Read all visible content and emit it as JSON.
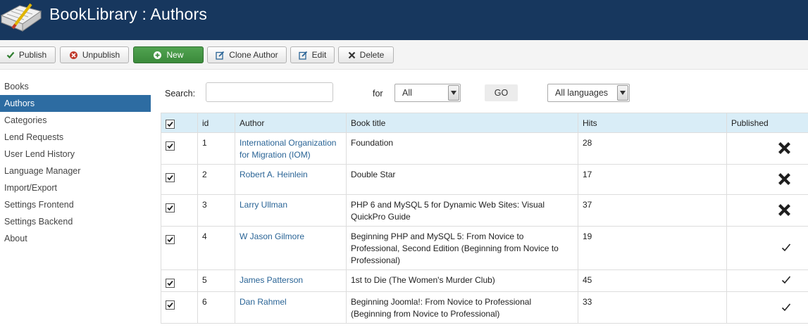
{
  "app": {
    "title": "BookLibrary : Authors",
    "header_color": "#17375e"
  },
  "toolbar": {
    "publish": "Publish",
    "unpublish": "Unpublish",
    "new": "New",
    "clone": "Clone Author",
    "edit": "Edit",
    "delete": "Delete"
  },
  "sidebar": {
    "items": [
      {
        "label": "Books"
      },
      {
        "label": "Authors",
        "active": true
      },
      {
        "label": "Categories"
      },
      {
        "label": "Lend Requests"
      },
      {
        "label": "User Lend History"
      },
      {
        "label": "Language Manager"
      },
      {
        "label": "Import/Export"
      },
      {
        "label": "Settings Frontend"
      },
      {
        "label": "Settings Backend"
      },
      {
        "label": "About"
      }
    ]
  },
  "filters": {
    "search_label": "Search:",
    "search_value": "",
    "for_label": "for",
    "for_value": "All",
    "go_label": "GO",
    "language_value": "All languages"
  },
  "table": {
    "headers": {
      "id": "id",
      "author": "Author",
      "book_title": "Book title",
      "hits": "Hits",
      "published": "Published"
    },
    "rows": [
      {
        "id": "1",
        "author": "International Organization for Migration (IOM)",
        "book_title": "Foundation",
        "hits": "28",
        "published": false
      },
      {
        "id": "2",
        "author": "Robert A. Heinlein",
        "book_title": "Double Star",
        "hits": "17",
        "published": false
      },
      {
        "id": "3",
        "author": "Larry Ullman",
        "book_title": "PHP 6 and MySQL 5 for Dynamic Web Sites: Visual QuickPro Guide",
        "hits": "37",
        "published": false
      },
      {
        "id": "4",
        "author": "W Jason Gilmore",
        "book_title": "Beginning PHP and MySQL 5: From Novice to Professional, Second Edition (Beginning from Novice to Professional)",
        "hits": "19",
        "published": true
      },
      {
        "id": "5",
        "author": "James Patterson",
        "book_title": "1st to Die (The Women's Murder Club)",
        "hits": "45",
        "published": true
      },
      {
        "id": "6",
        "author": "Dan Rahmel",
        "book_title": "Beginning Joomla!: From Novice to Professional (Beginning from Novice to Professional)",
        "hits": "33",
        "published": true
      }
    ]
  }
}
